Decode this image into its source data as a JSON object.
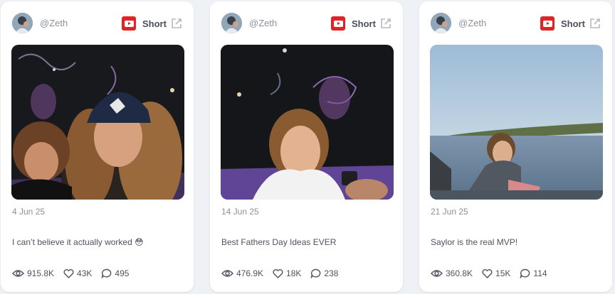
{
  "cards": [
    {
      "handle": "@Zeth",
      "platform_label": "Short",
      "date": "4 Jun 25",
      "caption": "I can’t believe it actually worked 😳",
      "views": "915.8K",
      "likes": "43K",
      "comments": "495"
    },
    {
      "handle": "@Zeth",
      "platform_label": "Short",
      "date": "14 Jun 25",
      "caption": "Best Fathers Day Ideas EVER",
      "views": "476.9K",
      "likes": "18K",
      "comments": "238"
    },
    {
      "handle": "@Zeth",
      "platform_label": "Short",
      "date": "21 Jun 25",
      "caption": "Saylor is the real MVP!",
      "views": "360.8K",
      "likes": "15K",
      "comments": "114"
    }
  ],
  "colors": {
    "background": "#eef1f5",
    "card": "#ffffff",
    "youtube_red": "#e02424",
    "text_muted": "#8a919c",
    "text": "#4d535d"
  },
  "icons": {
    "platform": "youtube-icon",
    "external": "external-link-icon",
    "views": "eye-icon",
    "likes": "heart-icon",
    "comments": "comment-icon"
  }
}
